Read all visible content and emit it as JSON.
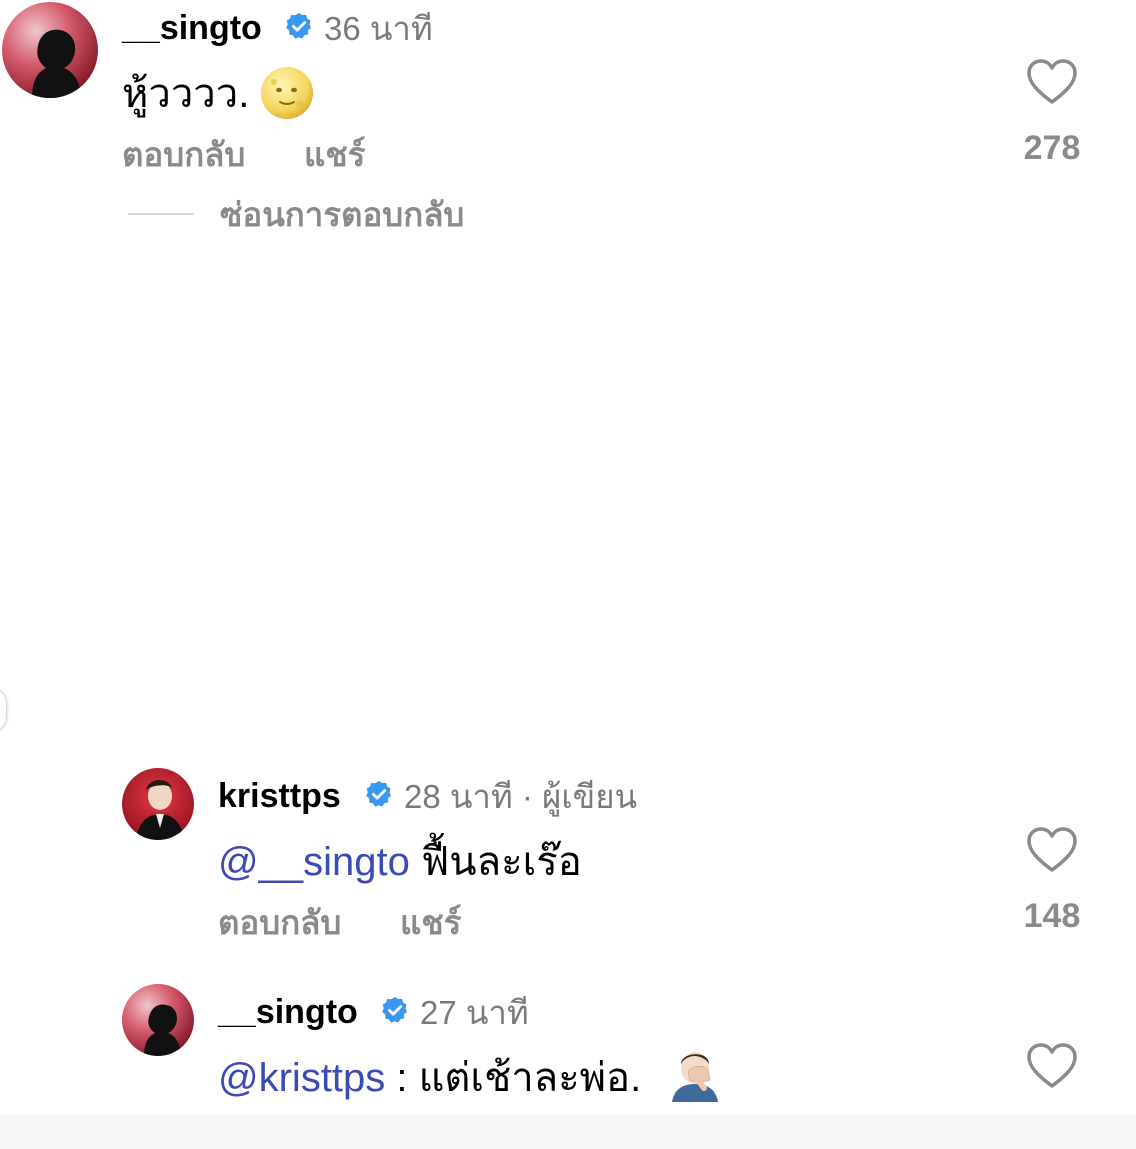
{
  "comments": [
    {
      "username": "__singto",
      "verified": true,
      "time": "36 นาที",
      "text": "หู้วววว.",
      "emoji": "full-moon-face",
      "reply_label": "ตอบกลับ",
      "share_label": "แชร์",
      "likes": "278",
      "hide_replies_label": "ซ่อนการตอบกลับ"
    }
  ],
  "replies": [
    {
      "username": "kristtps",
      "verified": true,
      "time": "28 นาที · ผู้เขียน",
      "mention": "@__singto",
      "text": " ฟื้นละเร๊อ",
      "reply_label": "ตอบกลับ",
      "share_label": "แชร์",
      "likes": "148"
    },
    {
      "username": "__singto",
      "verified": true,
      "time": "27 นาที",
      "mention": "@kristtps",
      "text": " : แต่เช้าละพ่อ.",
      "emoji": "man-facepalming"
    }
  ],
  "colors": {
    "mention": "#3b4bb3",
    "verified": "#3897f0",
    "secondary_text": "#8a8a8a"
  },
  "icons": [
    "heart-outline-icon",
    "verified-badge-icon"
  ]
}
